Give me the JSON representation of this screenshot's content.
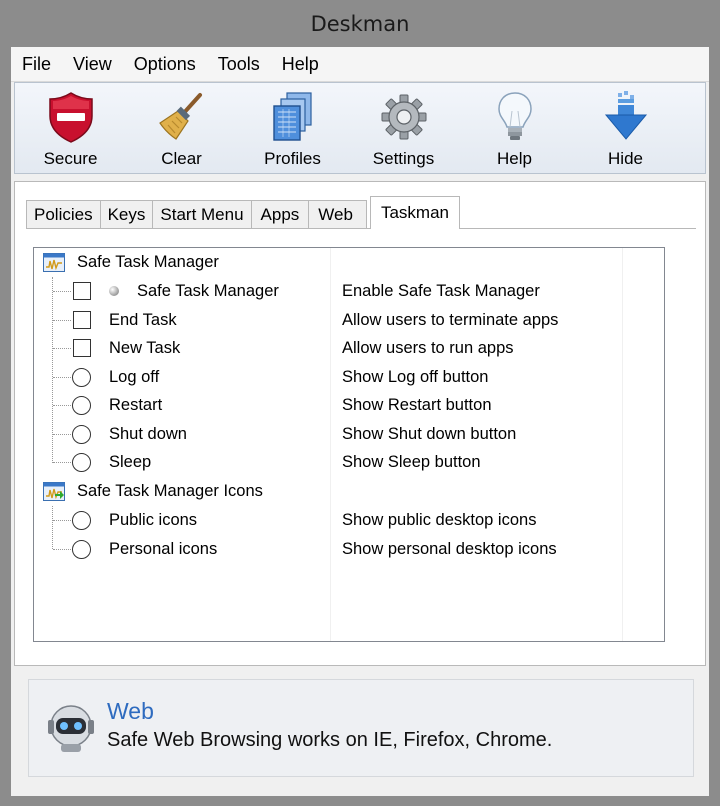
{
  "window": {
    "title": "Deskman"
  },
  "menu": [
    "File",
    "View",
    "Options",
    "Tools",
    "Help"
  ],
  "toolbar": [
    {
      "label": "Secure",
      "icon": "shield-icon"
    },
    {
      "label": "Clear",
      "icon": "broom-icon"
    },
    {
      "label": "Profiles",
      "icon": "profiles-icon"
    },
    {
      "label": "Settings",
      "icon": "gear-icon"
    },
    {
      "label": "Help",
      "icon": "lightbulb-icon"
    },
    {
      "label": "Hide",
      "icon": "down-arrow-icon"
    }
  ],
  "tabs": [
    "Policies",
    "Keys",
    "Start Menu",
    "Apps",
    "Web",
    "Taskman"
  ],
  "active_tab": "Taskman",
  "tree": {
    "group1": {
      "label": "Safe Task Manager",
      "items": [
        {
          "label": "Safe Task Manager",
          "desc": "Enable Safe Task Manager",
          "control": "checkbox"
        },
        {
          "label": "End Task",
          "desc": "Allow users to terminate apps",
          "control": "checkbox"
        },
        {
          "label": "New Task",
          "desc": "Allow users to run apps",
          "control": "checkbox"
        },
        {
          "label": "Log off",
          "desc": "Show Log off button",
          "control": "radio"
        },
        {
          "label": "Restart",
          "desc": "Show Restart button",
          "control": "radio"
        },
        {
          "label": "Shut down",
          "desc": "Show Shut down button",
          "control": "radio"
        },
        {
          "label": "Sleep",
          "desc": "Show Sleep button",
          "control": "radio"
        }
      ]
    },
    "group2": {
      "label": "Safe Task Manager Icons",
      "items": [
        {
          "label": "Public icons",
          "desc": "Show public desktop icons",
          "control": "radio"
        },
        {
          "label": "Personal icons",
          "desc": "Show personal desktop icons",
          "control": "radio"
        }
      ]
    }
  },
  "info": {
    "title": "Web",
    "text": "Safe Web Browsing works on IE, Firefox, Chrome."
  },
  "colors": {
    "accent": "#2e6bbf",
    "shield": "#c8102e"
  }
}
